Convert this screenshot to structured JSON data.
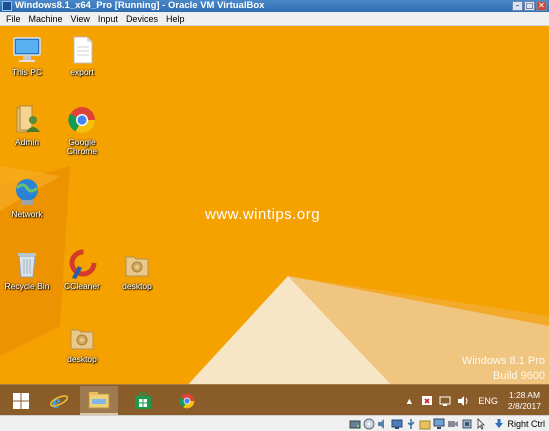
{
  "window": {
    "title": "Windows8.1_x64_Pro [Running] - Oracle VM VirtualBox",
    "minimize": "–",
    "maximize": "□",
    "close": "✕"
  },
  "menu": [
    "File",
    "Machine",
    "View",
    "Input",
    "Devices",
    "Help"
  ],
  "desktop": {
    "icons": [
      {
        "label": "This PC",
        "icon": "this-pc-icon"
      },
      {
        "label": "export",
        "icon": "file-icon"
      },
      {
        "label": "Admin",
        "icon": "user-folder-icon"
      },
      {
        "label": "Google\nChrome",
        "icon": "chrome-icon"
      },
      {
        "label": "Network",
        "icon": "network-icon"
      },
      {
        "label": "Recycle Bin",
        "icon": "recycle-bin-icon"
      },
      {
        "label": "CCleaner",
        "icon": "ccleaner-icon"
      },
      {
        "label": "desktop",
        "icon": "zip-folder-icon"
      },
      {
        "label": "desktop",
        "icon": "zip-folder-icon"
      }
    ],
    "watermark": "www.wintips.org",
    "os_name": "Windows 8.1 Pro",
    "build": "Build 9600"
  },
  "taskbar": {
    "buttons": [
      "start-icon",
      "internet-explorer-icon",
      "file-explorer-icon",
      "store-icon",
      "chrome-icon"
    ],
    "tray": {
      "language": "ENG",
      "time": "1:28 AM",
      "date": "2/8/2017"
    }
  },
  "statusbar": {
    "host_key": "Right Ctrl"
  },
  "colors": {
    "desktop_bg": "#f5a100",
    "taskbar_bg": "#8a5c2a",
    "titlebar": "#2f6db1"
  }
}
